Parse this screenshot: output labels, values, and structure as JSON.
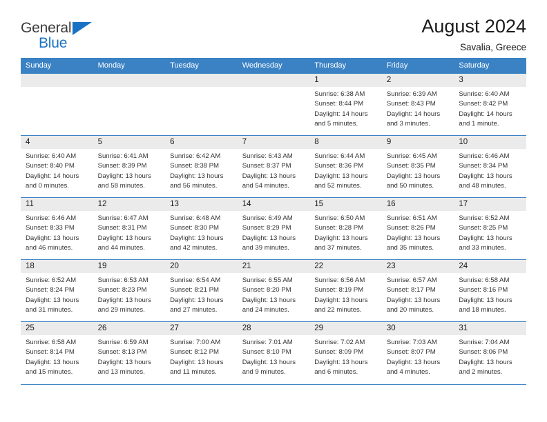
{
  "brand": {
    "name_top": "General",
    "name_bottom": "Blue",
    "color_dark": "#3b3b3b",
    "color_blue": "#1b72c4",
    "triangle_icon": "blue-triangle-icon"
  },
  "header": {
    "title": "August 2024",
    "location": "Savalia, Greece"
  },
  "theme": {
    "header_bg": "#3b82c4",
    "daynum_bg": "#ebebeb",
    "rule_color": "#3b82c4",
    "text_color": "#333333"
  },
  "weekday_headers": [
    "Sunday",
    "Monday",
    "Tuesday",
    "Wednesday",
    "Thursday",
    "Friday",
    "Saturday"
  ],
  "weeks": [
    [
      {
        "day": "",
        "empty": true,
        "sunrise": "",
        "sunset": "",
        "daylight1": "",
        "daylight2": ""
      },
      {
        "day": "",
        "empty": true,
        "sunrise": "",
        "sunset": "",
        "daylight1": "",
        "daylight2": ""
      },
      {
        "day": "",
        "empty": true,
        "sunrise": "",
        "sunset": "",
        "daylight1": "",
        "daylight2": ""
      },
      {
        "day": "",
        "empty": true,
        "sunrise": "",
        "sunset": "",
        "daylight1": "",
        "daylight2": ""
      },
      {
        "day": "1",
        "empty": false,
        "sunrise": "Sunrise: 6:38 AM",
        "sunset": "Sunset: 8:44 PM",
        "daylight1": "Daylight: 14 hours",
        "daylight2": "and 5 minutes."
      },
      {
        "day": "2",
        "empty": false,
        "sunrise": "Sunrise: 6:39 AM",
        "sunset": "Sunset: 8:43 PM",
        "daylight1": "Daylight: 14 hours",
        "daylight2": "and 3 minutes."
      },
      {
        "day": "3",
        "empty": false,
        "sunrise": "Sunrise: 6:40 AM",
        "sunset": "Sunset: 8:42 PM",
        "daylight1": "Daylight: 14 hours",
        "daylight2": "and 1 minute."
      }
    ],
    [
      {
        "day": "4",
        "empty": false,
        "sunrise": "Sunrise: 6:40 AM",
        "sunset": "Sunset: 8:40 PM",
        "daylight1": "Daylight: 14 hours",
        "daylight2": "and 0 minutes."
      },
      {
        "day": "5",
        "empty": false,
        "sunrise": "Sunrise: 6:41 AM",
        "sunset": "Sunset: 8:39 PM",
        "daylight1": "Daylight: 13 hours",
        "daylight2": "and 58 minutes."
      },
      {
        "day": "6",
        "empty": false,
        "sunrise": "Sunrise: 6:42 AM",
        "sunset": "Sunset: 8:38 PM",
        "daylight1": "Daylight: 13 hours",
        "daylight2": "and 56 minutes."
      },
      {
        "day": "7",
        "empty": false,
        "sunrise": "Sunrise: 6:43 AM",
        "sunset": "Sunset: 8:37 PM",
        "daylight1": "Daylight: 13 hours",
        "daylight2": "and 54 minutes."
      },
      {
        "day": "8",
        "empty": false,
        "sunrise": "Sunrise: 6:44 AM",
        "sunset": "Sunset: 8:36 PM",
        "daylight1": "Daylight: 13 hours",
        "daylight2": "and 52 minutes."
      },
      {
        "day": "9",
        "empty": false,
        "sunrise": "Sunrise: 6:45 AM",
        "sunset": "Sunset: 8:35 PM",
        "daylight1": "Daylight: 13 hours",
        "daylight2": "and 50 minutes."
      },
      {
        "day": "10",
        "empty": false,
        "sunrise": "Sunrise: 6:46 AM",
        "sunset": "Sunset: 8:34 PM",
        "daylight1": "Daylight: 13 hours",
        "daylight2": "and 48 minutes."
      }
    ],
    [
      {
        "day": "11",
        "empty": false,
        "sunrise": "Sunrise: 6:46 AM",
        "sunset": "Sunset: 8:33 PM",
        "daylight1": "Daylight: 13 hours",
        "daylight2": "and 46 minutes."
      },
      {
        "day": "12",
        "empty": false,
        "sunrise": "Sunrise: 6:47 AM",
        "sunset": "Sunset: 8:31 PM",
        "daylight1": "Daylight: 13 hours",
        "daylight2": "and 44 minutes."
      },
      {
        "day": "13",
        "empty": false,
        "sunrise": "Sunrise: 6:48 AM",
        "sunset": "Sunset: 8:30 PM",
        "daylight1": "Daylight: 13 hours",
        "daylight2": "and 42 minutes."
      },
      {
        "day": "14",
        "empty": false,
        "sunrise": "Sunrise: 6:49 AM",
        "sunset": "Sunset: 8:29 PM",
        "daylight1": "Daylight: 13 hours",
        "daylight2": "and 39 minutes."
      },
      {
        "day": "15",
        "empty": false,
        "sunrise": "Sunrise: 6:50 AM",
        "sunset": "Sunset: 8:28 PM",
        "daylight1": "Daylight: 13 hours",
        "daylight2": "and 37 minutes."
      },
      {
        "day": "16",
        "empty": false,
        "sunrise": "Sunrise: 6:51 AM",
        "sunset": "Sunset: 8:26 PM",
        "daylight1": "Daylight: 13 hours",
        "daylight2": "and 35 minutes."
      },
      {
        "day": "17",
        "empty": false,
        "sunrise": "Sunrise: 6:52 AM",
        "sunset": "Sunset: 8:25 PM",
        "daylight1": "Daylight: 13 hours",
        "daylight2": "and 33 minutes."
      }
    ],
    [
      {
        "day": "18",
        "empty": false,
        "sunrise": "Sunrise: 6:52 AM",
        "sunset": "Sunset: 8:24 PM",
        "daylight1": "Daylight: 13 hours",
        "daylight2": "and 31 minutes."
      },
      {
        "day": "19",
        "empty": false,
        "sunrise": "Sunrise: 6:53 AM",
        "sunset": "Sunset: 8:23 PM",
        "daylight1": "Daylight: 13 hours",
        "daylight2": "and 29 minutes."
      },
      {
        "day": "20",
        "empty": false,
        "sunrise": "Sunrise: 6:54 AM",
        "sunset": "Sunset: 8:21 PM",
        "daylight1": "Daylight: 13 hours",
        "daylight2": "and 27 minutes."
      },
      {
        "day": "21",
        "empty": false,
        "sunrise": "Sunrise: 6:55 AM",
        "sunset": "Sunset: 8:20 PM",
        "daylight1": "Daylight: 13 hours",
        "daylight2": "and 24 minutes."
      },
      {
        "day": "22",
        "empty": false,
        "sunrise": "Sunrise: 6:56 AM",
        "sunset": "Sunset: 8:19 PM",
        "daylight1": "Daylight: 13 hours",
        "daylight2": "and 22 minutes."
      },
      {
        "day": "23",
        "empty": false,
        "sunrise": "Sunrise: 6:57 AM",
        "sunset": "Sunset: 8:17 PM",
        "daylight1": "Daylight: 13 hours",
        "daylight2": "and 20 minutes."
      },
      {
        "day": "24",
        "empty": false,
        "sunrise": "Sunrise: 6:58 AM",
        "sunset": "Sunset: 8:16 PM",
        "daylight1": "Daylight: 13 hours",
        "daylight2": "and 18 minutes."
      }
    ],
    [
      {
        "day": "25",
        "empty": false,
        "sunrise": "Sunrise: 6:58 AM",
        "sunset": "Sunset: 8:14 PM",
        "daylight1": "Daylight: 13 hours",
        "daylight2": "and 15 minutes."
      },
      {
        "day": "26",
        "empty": false,
        "sunrise": "Sunrise: 6:59 AM",
        "sunset": "Sunset: 8:13 PM",
        "daylight1": "Daylight: 13 hours",
        "daylight2": "and 13 minutes."
      },
      {
        "day": "27",
        "empty": false,
        "sunrise": "Sunrise: 7:00 AM",
        "sunset": "Sunset: 8:12 PM",
        "daylight1": "Daylight: 13 hours",
        "daylight2": "and 11 minutes."
      },
      {
        "day": "28",
        "empty": false,
        "sunrise": "Sunrise: 7:01 AM",
        "sunset": "Sunset: 8:10 PM",
        "daylight1": "Daylight: 13 hours",
        "daylight2": "and 9 minutes."
      },
      {
        "day": "29",
        "empty": false,
        "sunrise": "Sunrise: 7:02 AM",
        "sunset": "Sunset: 8:09 PM",
        "daylight1": "Daylight: 13 hours",
        "daylight2": "and 6 minutes."
      },
      {
        "day": "30",
        "empty": false,
        "sunrise": "Sunrise: 7:03 AM",
        "sunset": "Sunset: 8:07 PM",
        "daylight1": "Daylight: 13 hours",
        "daylight2": "and 4 minutes."
      },
      {
        "day": "31",
        "empty": false,
        "sunrise": "Sunrise: 7:04 AM",
        "sunset": "Sunset: 8:06 PM",
        "daylight1": "Daylight: 13 hours",
        "daylight2": "and 2 minutes."
      }
    ]
  ]
}
